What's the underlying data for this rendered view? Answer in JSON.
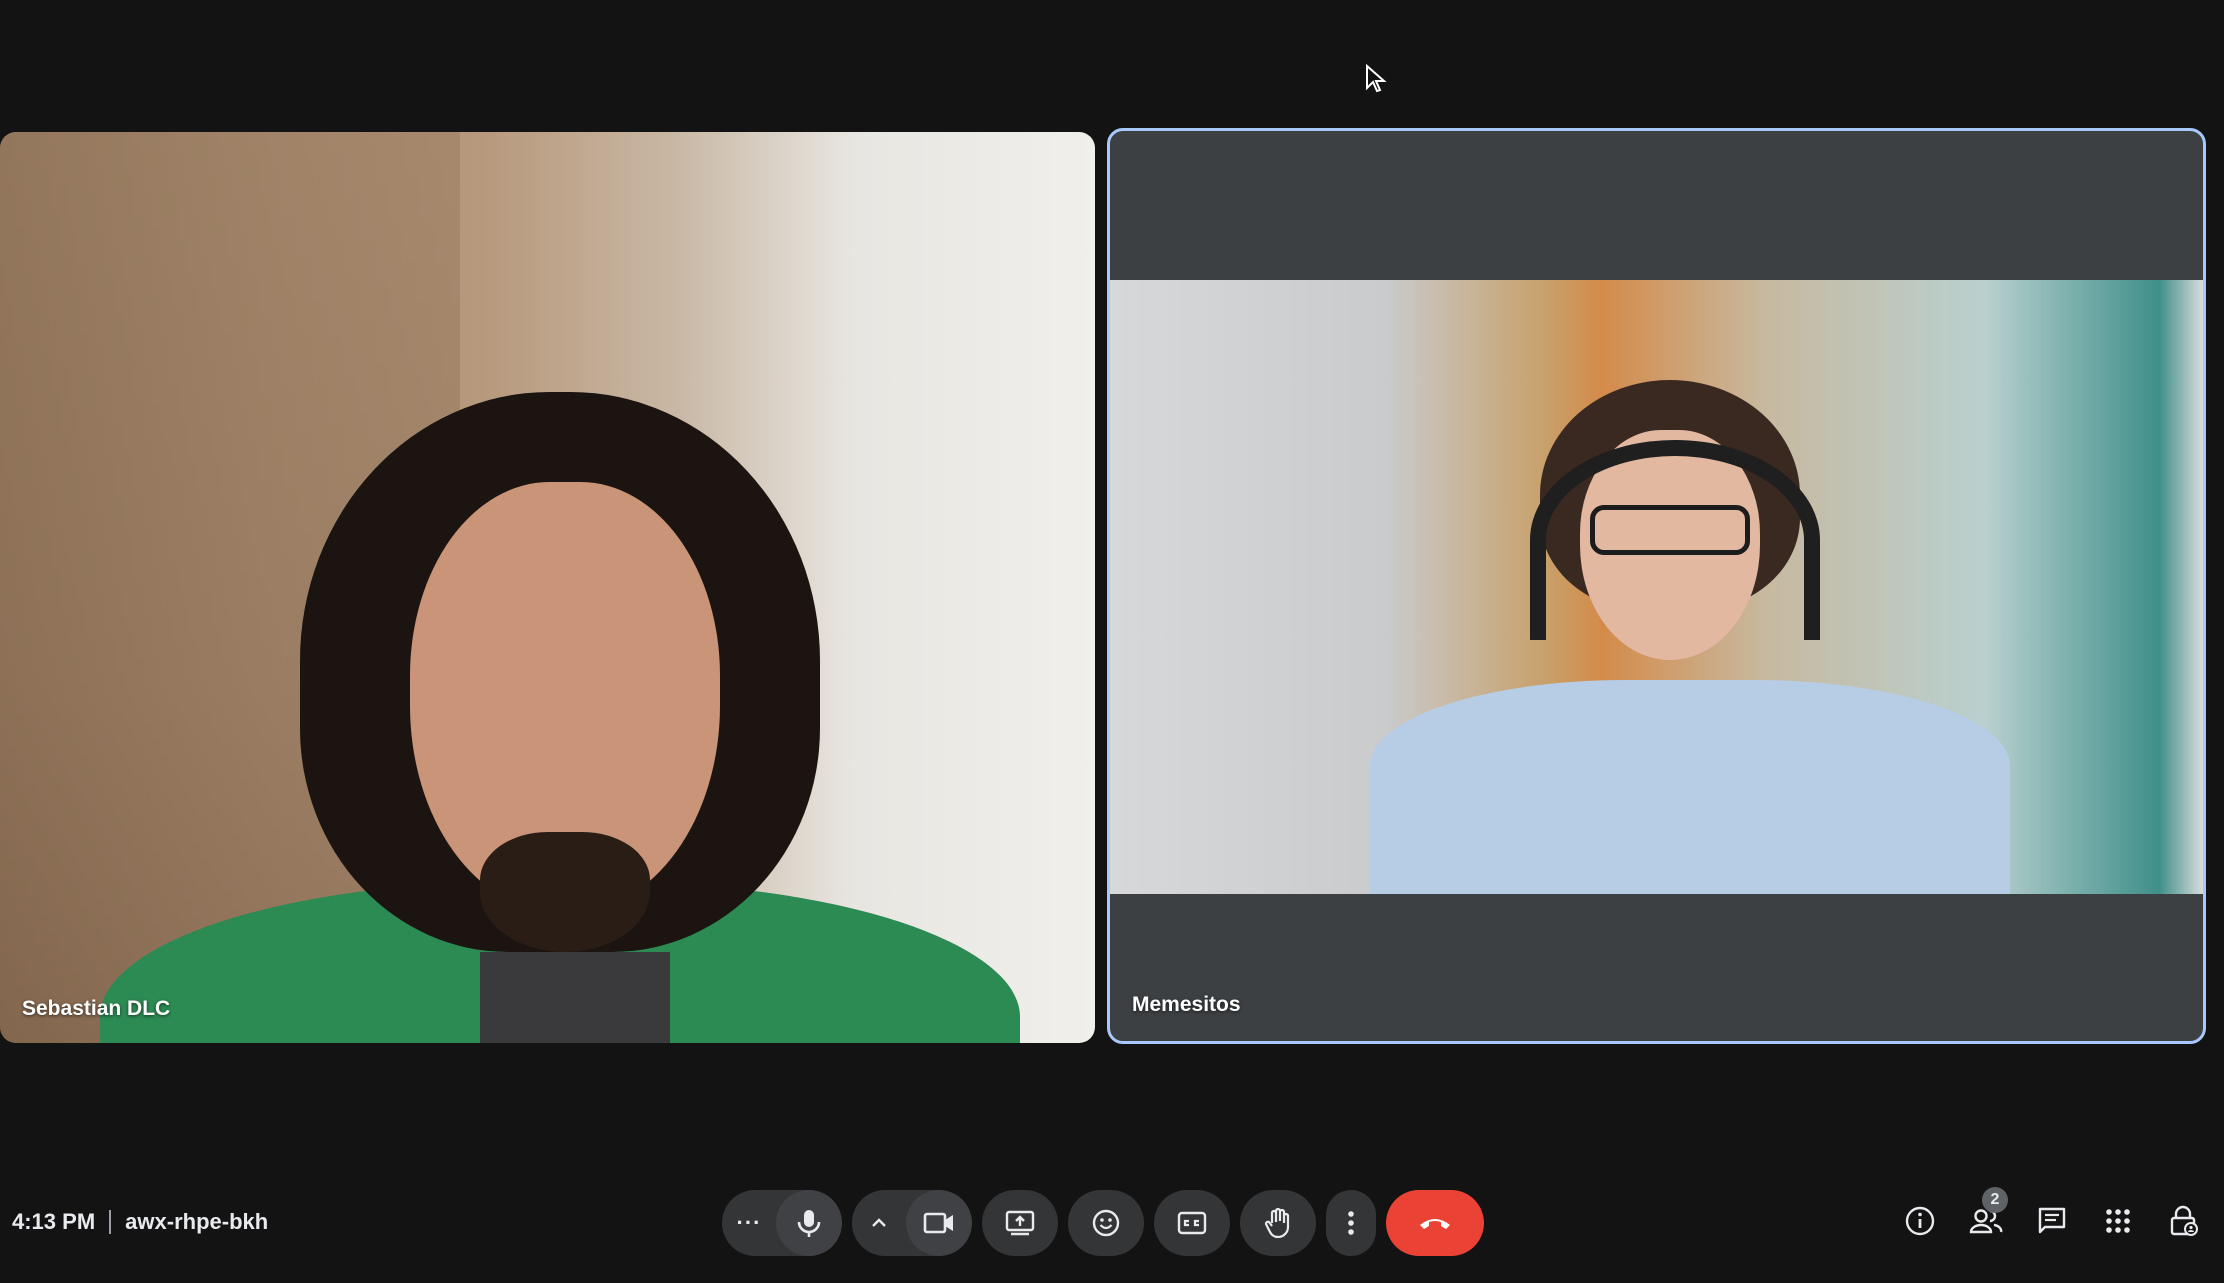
{
  "participants": [
    {
      "name": "Sebastian DLC"
    },
    {
      "name": "Memesitos"
    }
  ],
  "meeting": {
    "time": "4:13 PM",
    "code": "awx-rhpe-bkh"
  },
  "toolbar": {
    "more_dots": "···"
  },
  "people_count": "2",
  "colors": {
    "background": "#131314",
    "button_bg": "#333537",
    "end_call": "#ea4335",
    "active_speaker_border": "#a8c7fa"
  },
  "icons": {
    "mic": "mic-icon",
    "camera": "camera-icon",
    "present": "present-screen-icon",
    "emoji": "emoji-icon",
    "captions": "captions-icon",
    "hand": "raise-hand-icon",
    "more": "more-vert-icon",
    "end_call": "phone-end-icon",
    "info": "info-icon",
    "people": "people-icon",
    "chat": "chat-icon",
    "activities": "apps-grid-icon",
    "host_controls": "lock-person-icon"
  }
}
